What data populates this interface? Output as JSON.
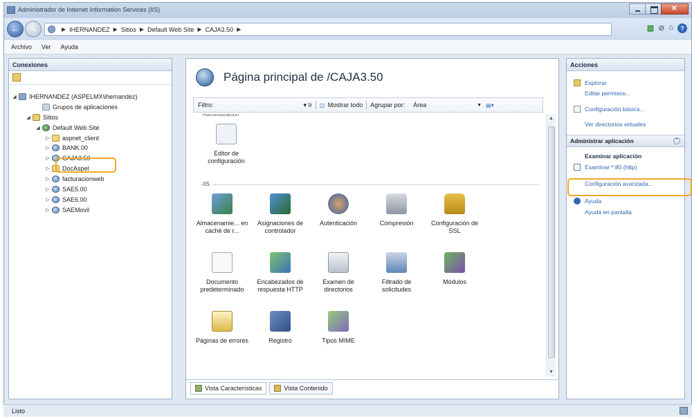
{
  "window": {
    "title": "Administrador de Internet Information Services (IIS)"
  },
  "address": {
    "crumbs": [
      "IHERNANDEZ",
      "Sitios",
      "Default Web Site",
      "CAJA3.50"
    ]
  },
  "menu": [
    "Archivo",
    "Ver",
    "Ayuda"
  ],
  "connections": {
    "header": "Conexiones",
    "tree": [
      {
        "label": "IHERNANDEZ (ASPELMX\\ihernandez)",
        "icon": "server-icon",
        "expander": "◢"
      },
      {
        "label": "Grupos de aplicaciones",
        "icon": "application-pools-icon",
        "expander": ""
      },
      {
        "label": "Sitios",
        "icon": "sites-icon",
        "expander": "◢"
      },
      {
        "label": "Default Web Site",
        "icon": "globe-icon",
        "expander": "◢"
      },
      {
        "label": "aspnet_client",
        "icon": "folder-icon",
        "expander": "▷"
      },
      {
        "label": "BANK.00",
        "icon": "application-icon",
        "expander": "▷"
      },
      {
        "label": "CAJA3.50",
        "icon": "application-icon",
        "expander": "▷"
      },
      {
        "label": "DocAspel",
        "icon": "folder-icon",
        "expander": "▷"
      },
      {
        "label": "facturacionweb",
        "icon": "application-icon",
        "expander": "▷"
      },
      {
        "label": "SAE5.00",
        "icon": "application-icon",
        "expander": "▷"
      },
      {
        "label": "SAE6.00",
        "icon": "application-icon",
        "expander": "▷"
      },
      {
        "label": "SAEMovil",
        "icon": "application-icon",
        "expander": "▷"
      }
    ]
  },
  "content": {
    "title": "Página principal de /CAJA3.50",
    "filter": {
      "label": "Filtro:",
      "go": "▾ Ir",
      "show_all": "Mostrar todo",
      "group_by_label": "Agrupar por:",
      "group_by_value": "Área"
    },
    "category_cut": "Administración",
    "category_iis": "IIS",
    "features": [
      "Editor de configuración",
      "Almacenamie... en caché de r...",
      "Asignaciones de controlador",
      "Autenticación",
      "Compresión",
      "Configuración de SSL",
      "Documento predeterminado",
      "Encabezados de respuesta HTTP",
      "Examen de directorios",
      "Filtrado de solicitudes",
      "Módulos",
      "Páginas de errores",
      "Registro",
      "Tipos MIME"
    ],
    "view_tabs": [
      "Vista Características",
      "Vista Contenido"
    ]
  },
  "actions": {
    "header": "Acciones",
    "items": [
      "Explorar",
      "Editar permisos...",
      "Configuración básica...",
      "Ver directorios virtuales"
    ],
    "manage_section": "Administrar aplicación",
    "browse_sub": "Examinar aplicación",
    "browse_link": "Examinar *:80 (http)",
    "advanced_link": "Configuración avanzada...",
    "help": "Ayuda",
    "online_help": "Ayuda en pantalla"
  },
  "status": "Listo",
  "colors": {
    "highlight": "#f5a623",
    "link": "#2e64b0"
  }
}
